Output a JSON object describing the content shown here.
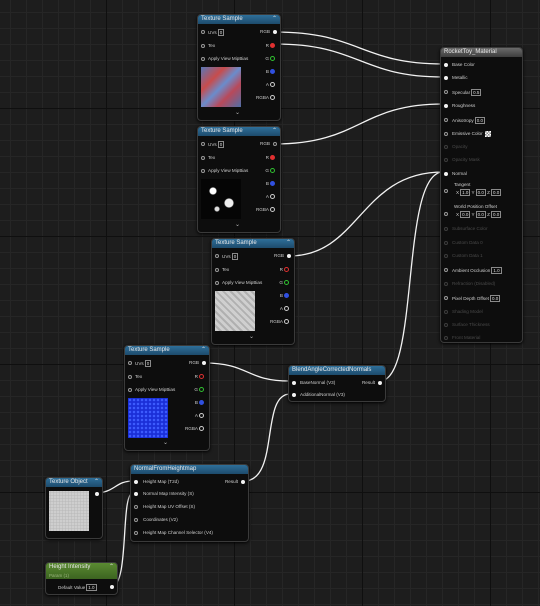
{
  "texture_sample_title": "Texture Sample",
  "texture_sample_inputs": {
    "uvs": "UVs",
    "uvs_value": "0",
    "tex": "Tex",
    "apply_mip": "Apply View MipBias"
  },
  "texture_sample_outputs": {
    "rgb": "RGB",
    "r": "R",
    "g": "G",
    "b": "B",
    "a": "A",
    "rgba": "RGBA"
  },
  "material": {
    "title": "RocketToy_Material",
    "pins": {
      "base_color": "Base Color",
      "metallic": "Metallic",
      "specular": "Specular",
      "specular_value": "0.5",
      "roughness": "Roughness",
      "anisotropy": "Anisotropy",
      "anisotropy_value": "0.0",
      "emissive": "Emissive Color",
      "opacity": "Opacity",
      "opacity_mask": "Opacity Mask",
      "normal": "Normal",
      "tangent": "Tangent",
      "wpo": "World Position Offset",
      "subsurface": "Subsurface Color",
      "custom0": "Custom Data 0",
      "custom1": "Custom Data 1",
      "ao": "Ambient Occlusion",
      "ao_value": "1.0",
      "refraction": "Refraction (Disabled)",
      "pdo": "Pixel Depth Offset",
      "pdo_value": "0.0",
      "shading": "Shading Model",
      "thickness": "Surface Thickness",
      "front": "Front Material"
    },
    "tangent_vec": {
      "x": "X",
      "xv": "1.0",
      "y": "Y",
      "yv": "0.0",
      "z": "Z",
      "zv": "0.0"
    },
    "wpo_vec": {
      "x": "X",
      "xv": "0.0",
      "y": "Y",
      "yv": "0.0",
      "z": "Z",
      "zv": "0.0"
    }
  },
  "blend": {
    "title": "BlendAngleCorrectedNormals",
    "base": "BaseNormal (V3)",
    "add": "AdditionalNormal (V3)",
    "result": "Result"
  },
  "nfh": {
    "title": "NormalFromHeightmap",
    "in1": "Height Map (T2d)",
    "in2": "Normal Map Intensity (S)",
    "in3": "Height Map UV Offset (S)",
    "in4": "Coordinates (V2)",
    "in5": "Height Map Channel Selector (V4)",
    "result": "Result"
  },
  "tex_object": {
    "title": "Texture Object"
  },
  "height_intensity": {
    "title": "Height Intensity",
    "subtitle": "Param (1)",
    "label": "Default Value",
    "value": "1.0"
  },
  "colors": {
    "wire": "#f2f2f2",
    "header_blue": "#2e6f9a",
    "header_grey": "#5c5c5c",
    "header_green": "#4f7a2c",
    "pin_red": "#e03030",
    "pin_green": "#30c030",
    "pin_blue": "#3050e0"
  }
}
